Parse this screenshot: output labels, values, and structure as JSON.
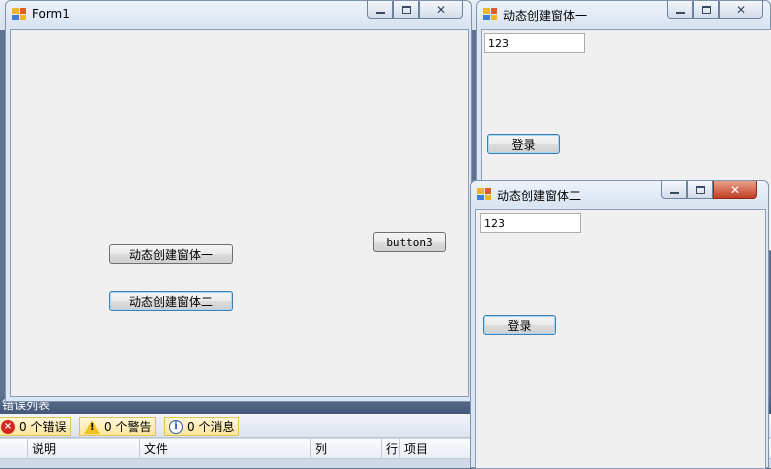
{
  "form1": {
    "title": "Form1",
    "buttons": {
      "create_window_one": "动态创建窗体一",
      "create_window_two": "动态创建窗体二",
      "button3": "button3"
    }
  },
  "dynamic_window_one": {
    "title": "动态创建窗体一",
    "textbox_value": "123",
    "login_button": "登录"
  },
  "dynamic_window_two": {
    "title": "动态创建窗体二",
    "textbox_value": "123",
    "login_button": "登录"
  },
  "error_list": {
    "title": "错误列表",
    "errors_button": "0 个错误",
    "warnings_button": "0 个警告",
    "messages_button": "0 个消息",
    "columns": [
      "说明",
      "文件",
      "列",
      "行",
      "项目"
    ]
  },
  "icons": {
    "window_icon": "windows-forms-icon",
    "error_icon": "error-icon",
    "warning_icon": "warning-icon",
    "info_icon": "info-icon"
  }
}
